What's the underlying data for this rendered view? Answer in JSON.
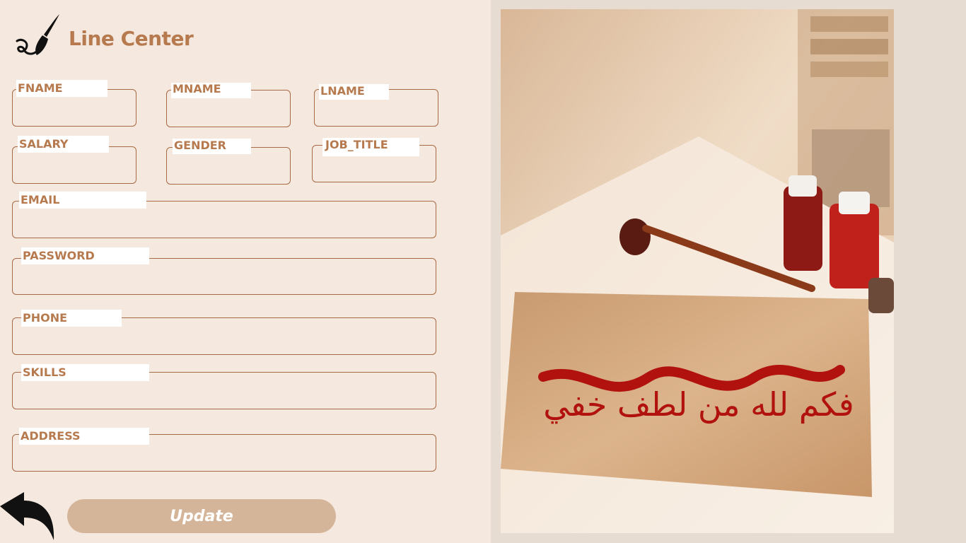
{
  "brand": {
    "name": "Line Center",
    "logo_icon": "calligraphy-brush-icon"
  },
  "form": {
    "fname": {
      "label": "FNAME",
      "value": ""
    },
    "mname": {
      "label": "MNAME",
      "value": ""
    },
    "lname": {
      "label": "LNAME",
      "value": ""
    },
    "salary": {
      "label": "SALARY",
      "value": ""
    },
    "gender": {
      "label": "GENDER",
      "value": ""
    },
    "job_title": {
      "label": "JOB_TITLE",
      "value": ""
    },
    "email": {
      "label": "EMAIL",
      "value": ""
    },
    "password": {
      "label": "PASSWORD",
      "value": ""
    },
    "phone": {
      "label": "PHONE",
      "value": ""
    },
    "skills": {
      "label": "SKILLS",
      "value": ""
    },
    "address": {
      "label": "ADDRESS",
      "value": ""
    }
  },
  "actions": {
    "update_label": "Update",
    "back_icon": "back-arrow-icon"
  },
  "image": {
    "calligraphy_text": "فكم لله من لطف خفي"
  },
  "colors": {
    "accent": "#b67a4e",
    "background": "#f5e8de",
    "button": "#d4b59a",
    "border": "#a66a44"
  }
}
